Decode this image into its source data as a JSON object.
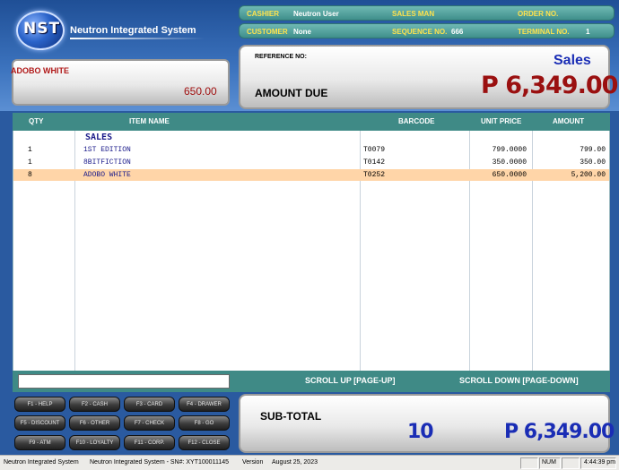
{
  "brand": {
    "logo_text": "NST",
    "name": "Neutron Integrated System"
  },
  "info_row1": {
    "cashier_label": "CASHIER",
    "cashier_value": "Neutron User",
    "salesman_label": "SALES MAN",
    "salesman_value": "",
    "order_label": "ORDER NO.",
    "order_value": ""
  },
  "info_row2": {
    "customer_label": "CUSTOMER",
    "customer_value": "None",
    "sequence_label": "SEQUENCE NO.",
    "sequence_value": "666",
    "terminal_label": "TERMINAL NO.",
    "terminal_value": "1"
  },
  "current_item": {
    "name": "ADOBO WHITE",
    "price": "650.00"
  },
  "amount": {
    "reference_label": "REFERENCE NO:",
    "reference_value": "",
    "mode": "Sales",
    "due_label": "AMOUNT DUE",
    "due_value": "P 6,349.00"
  },
  "grid": {
    "headers": {
      "qty": "QTY",
      "item": "ITEM NAME",
      "barcode": "BARCODE",
      "price": "UNIT PRICE",
      "amount": "AMOUNT"
    },
    "section": "SALES",
    "rows": [
      {
        "qty": "1",
        "name": "1ST EDITION",
        "barcode": "T0079",
        "price": "799.0000",
        "amount": "799.00"
      },
      {
        "qty": "1",
        "name": "8BITFICTION",
        "barcode": "T0142",
        "price": "350.0000",
        "amount": "350.00"
      },
      {
        "qty": "8",
        "name": "ADOBO WHITE",
        "barcode": "T0252",
        "price": "650.0000",
        "amount": "5,200.00"
      }
    ]
  },
  "scan": {
    "value": ""
  },
  "scroll": {
    "up": "SCROLL UP [PAGE-UP]",
    "down": "SCROLL DOWN [PAGE-DOWN]"
  },
  "fkeys": [
    "F1 - HELP",
    "F2 - CASH",
    "F3 - CARD",
    "F4 - DRAWER",
    "F5 - DISCOUNT",
    "F6 - OTHER",
    "F7 - CHECK",
    "F8 - GO",
    "F9 - ATM",
    "F10 - LOYALTY",
    "F11 - CORP.",
    "F12 - CLOSE"
  ],
  "subtotal": {
    "label": "SUB-TOTAL",
    "count": "10",
    "value": "P 6,349.00"
  },
  "status": {
    "app": "Neutron Integrated System",
    "serial": "Neutron Integrated System - SN#: XYT100011145",
    "version_label": "Version",
    "version_date": "August 25, 2023",
    "num": "NUM",
    "time": "4:44:39 pm"
  }
}
